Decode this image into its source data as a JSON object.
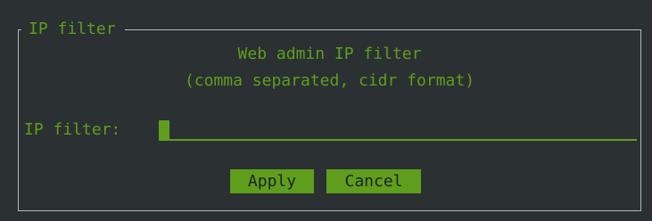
{
  "dialog": {
    "title": "IP filter",
    "heading_line1": "Web admin IP filter",
    "heading_line2": "(comma separated, cidr format)"
  },
  "field": {
    "label": "IP filter:",
    "value": ""
  },
  "buttons": {
    "apply_label": "Apply",
    "cancel_label": "Cancel"
  },
  "colors": {
    "background": "#2b3033",
    "accent": "#5f9e1c",
    "border": "#b7b9b9"
  }
}
